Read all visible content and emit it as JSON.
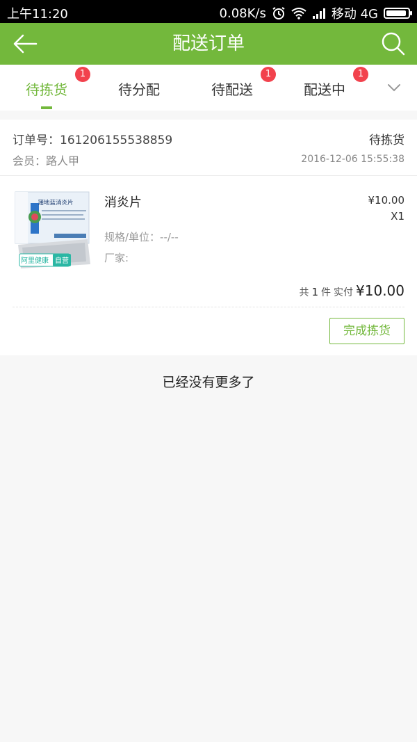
{
  "status_bar": {
    "time": "上午11:20",
    "speed": "0.08K/s",
    "carrier": "移动 4G",
    "icons": [
      "alarm-icon",
      "wifi-icon",
      "signal-icon",
      "battery-icon"
    ]
  },
  "header": {
    "title": "配送订单",
    "back_icon": "arrow-left-icon",
    "search_icon": "search-icon",
    "color": "#73b83c"
  },
  "tabs": [
    {
      "label": "待拣货",
      "badge": "1",
      "active": true
    },
    {
      "label": "待分配",
      "badge": "",
      "active": false
    },
    {
      "label": "待配送",
      "badge": "1",
      "active": false
    },
    {
      "label": "配送中",
      "badge": "1",
      "active": false
    }
  ],
  "order": {
    "number": "订单号：161206155538859",
    "status": "待拣货",
    "member": "会员：路人甲",
    "time": "2016-12-06 15:55:38",
    "product": {
      "name": "消炎片",
      "spec": "规格/单位：--/--",
      "maker": "厂家:",
      "price": "¥10.00",
      "qty": "X1",
      "box_title": "蒲地蓝消炎片",
      "store_tag": "阿里健康",
      "store_tag_self": "自营"
    },
    "total": {
      "prefix": "共",
      "count": "1",
      "unit": "件",
      "paid_label": "实付",
      "amount": "¥10.00"
    },
    "action_label": "完成拣货"
  },
  "footer_text": "已经没有更多了",
  "colors": {
    "accent": "#73b83c",
    "badge": "#f2424d"
  }
}
